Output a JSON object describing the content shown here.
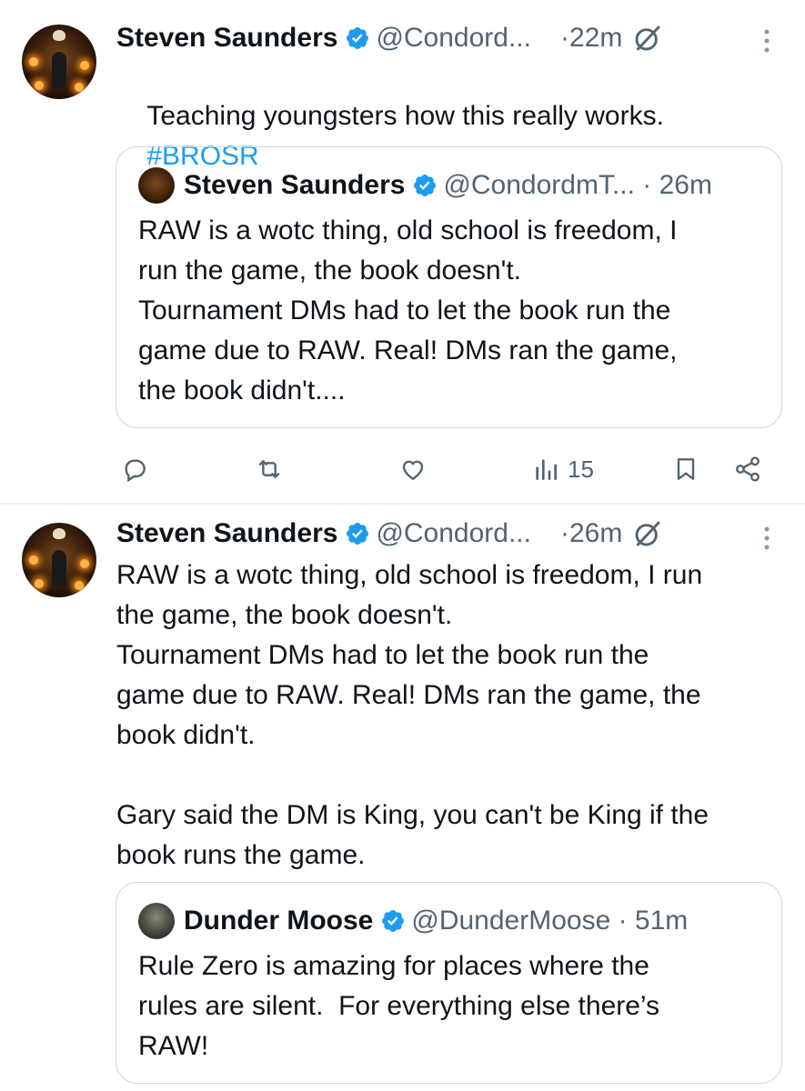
{
  "tweet1": {
    "name": "Steven Saunders",
    "handle": "@Condord...",
    "time": "·22m",
    "text": "Teaching youngsters how this really works.",
    "hashtag": "#BROSR",
    "quote": {
      "name": "Steven Saunders",
      "handle": "@CondordmT... · 26m",
      "text": "RAW is a wotc thing, old school is freedom, I\nrun the game, the book doesn't.\nTournament DMs had to let the book run the\ngame due to RAW. Real! DMs ran the game,\nthe book didn't...."
    },
    "actions": {
      "reply_icon": "reply-icon",
      "retweet_icon": "retweet-icon",
      "like_icon": "like-icon",
      "views_icon": "views-icon",
      "views_count": "15",
      "bookmark_icon": "bookmark-icon",
      "share_icon": "share-icon"
    }
  },
  "tweet2": {
    "name": "Steven Saunders",
    "handle": "@Condord...",
    "time": "·26m",
    "text": "RAW is a wotc thing, old school is freedom, I run\nthe game, the book doesn't.\nTournament DMs had to let the book run the\ngame due to RAW. Real! DMs ran the game, the\nbook didn't.\n\nGary said the DM is King, you can't be King if the\nbook runs the game.",
    "quote": {
      "name": "Dunder Moose",
      "handle": "@DunderMoose · 51m",
      "text": "Rule Zero is amazing for places where the\nrules are silent.  For everything else there’s\nRAW!"
    }
  },
  "colors": {
    "text": "#0f1419",
    "secondary": "#536471",
    "accent": "#1d9bf0",
    "border": "#cfd9de",
    "divider": "#eff3f4"
  }
}
